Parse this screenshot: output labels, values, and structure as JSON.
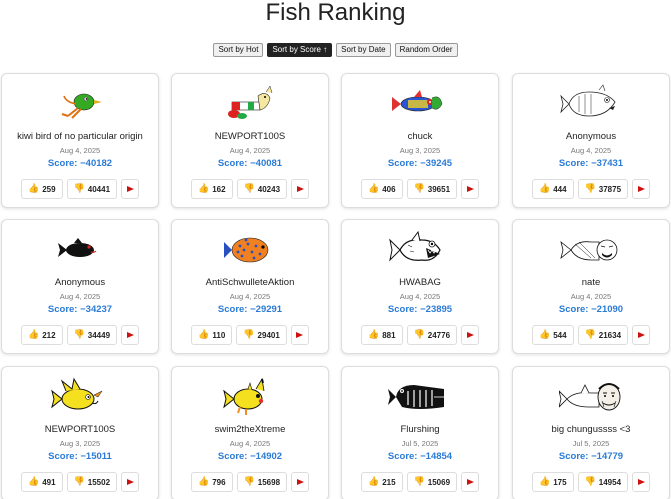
{
  "page": {
    "title": "Fish Ranking"
  },
  "sort": {
    "buttons": [
      {
        "label": "Sort by Hot",
        "active": false
      },
      {
        "label": "Sort by Score ↑",
        "active": true
      },
      {
        "label": "Sort by Date",
        "active": false
      },
      {
        "label": "Random Order",
        "active": false
      }
    ]
  },
  "fish": [
    {
      "name": "kiwi bird of no particular origin",
      "date": "Aug 4, 2025",
      "score": "Score: −40182",
      "up": "259",
      "down": "40441",
      "art": "kiwi"
    },
    {
      "name": "NEWPORT100S",
      "date": "Aug 4, 2025",
      "score": "Score: −40081",
      "up": "162",
      "down": "40243",
      "art": "newport"
    },
    {
      "name": "chuck",
      "date": "Aug 3, 2025",
      "score": "Score: −39245",
      "up": "406",
      "down": "39651",
      "art": "chuck"
    },
    {
      "name": "Anonymous",
      "date": "Aug 4, 2025",
      "score": "Score: −37431",
      "up": "444",
      "down": "37875",
      "art": "sketch"
    },
    {
      "name": "Anonymous",
      "date": "Aug 4, 2025",
      "score": "Score: −34237",
      "up": "212",
      "down": "34449",
      "art": "black"
    },
    {
      "name": "AntiSchwulleteAktion",
      "date": "Aug 4, 2025",
      "score": "Score: −29291",
      "up": "110",
      "down": "29401",
      "art": "angel"
    },
    {
      "name": "HWABAG",
      "date": "Aug 4, 2025",
      "score": "Score: −23895",
      "up": "881",
      "down": "24776",
      "art": "piranha"
    },
    {
      "name": "nate",
      "date": "Aug 4, 2025",
      "score": "Score: −21090",
      "up": "544",
      "down": "21634",
      "art": "trollfish"
    },
    {
      "name": "NEWPORT100S",
      "date": "Aug 3, 2025",
      "score": "Score: −15011",
      "up": "491",
      "down": "15502",
      "art": "yellowhedgehog"
    },
    {
      "name": "swim2theXtreme",
      "date": "Aug 4, 2025",
      "score": "Score: −14902",
      "up": "796",
      "down": "15698",
      "art": "yellowpika"
    },
    {
      "name": "Flurshing",
      "date": "Jul 5, 2025",
      "score": "Score: −14854",
      "up": "215",
      "down": "15069",
      "art": "whale"
    },
    {
      "name": "big chungussss <3",
      "date": "Jul 5, 2025",
      "score": "Score: −14779",
      "up": "175",
      "down": "14954",
      "art": "faceshark"
    }
  ],
  "icons": {
    "upvote": "thumbs-up-icon",
    "downvote": "thumbs-down-icon",
    "report": "report-flag-icon"
  },
  "colors": {
    "score": "#2b7bd6",
    "active_sort": "#222222",
    "flag": "#cc1111"
  }
}
